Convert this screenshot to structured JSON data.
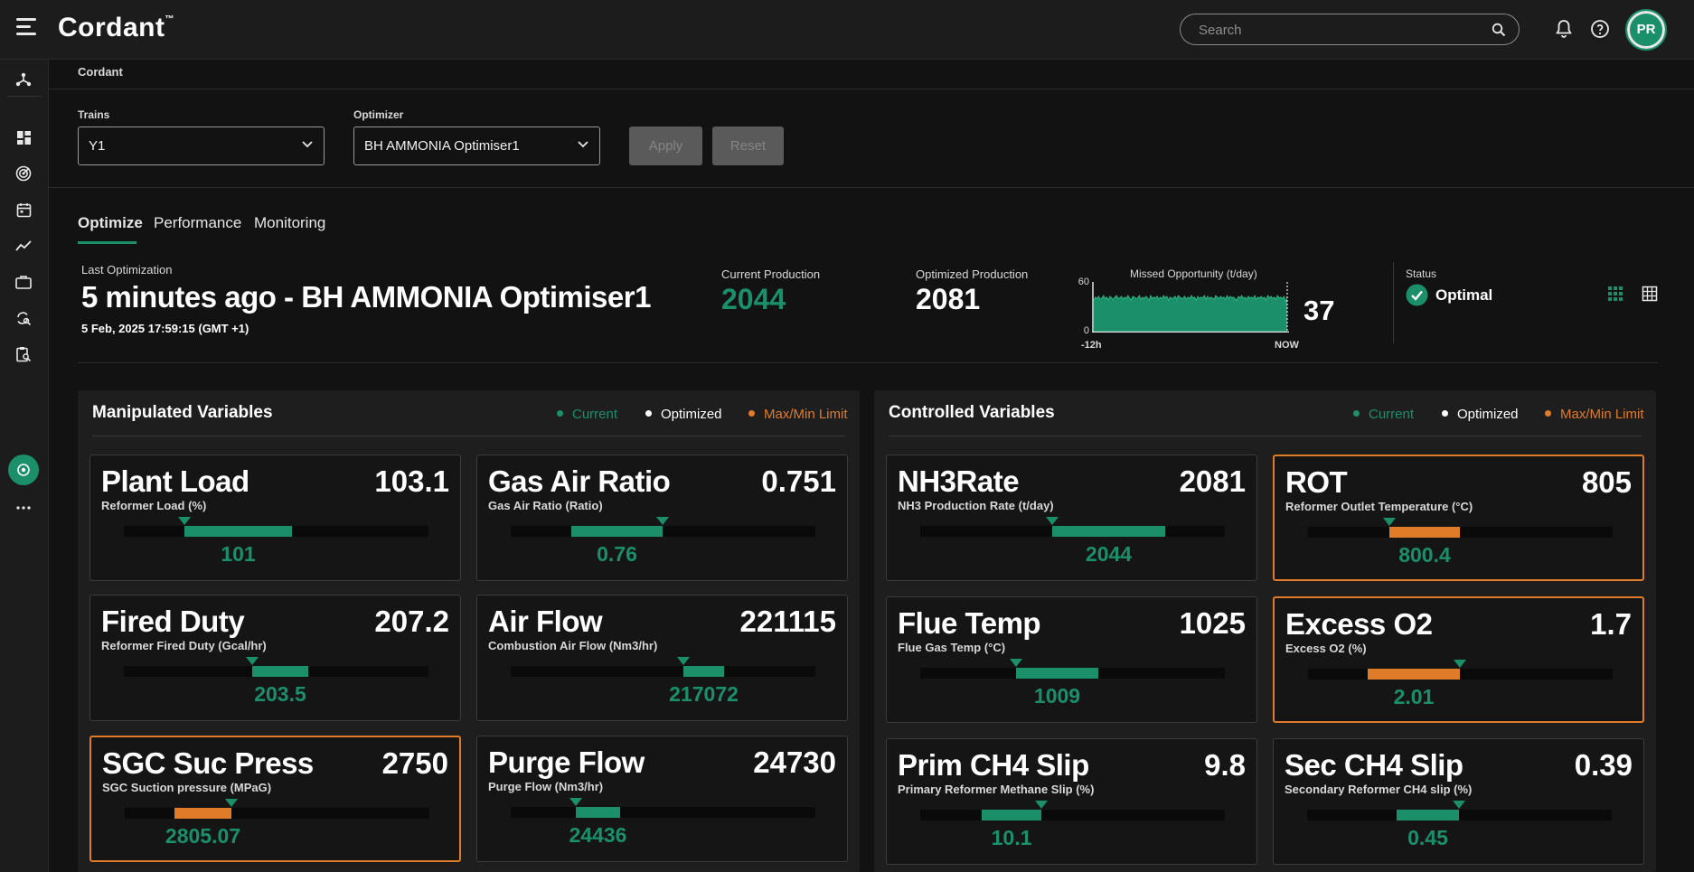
{
  "app": {
    "brand": "Cordant",
    "trademark": "™"
  },
  "search": {
    "placeholder": "Search"
  },
  "user": {
    "initials": "PR"
  },
  "breadcrumb": "Cordant",
  "filters": {
    "trains_label": "Trains",
    "trains_value": "Y1",
    "optimizer_label": "Optimizer",
    "optimizer_value": "BH AMMONIA Optimiser1",
    "apply_label": "Apply",
    "reset_label": "Reset"
  },
  "tabs": [
    {
      "label": "Optimize",
      "active": true
    },
    {
      "label": "Performance",
      "active": false
    },
    {
      "label": "Monitoring",
      "active": false
    }
  ],
  "summary": {
    "last_opt_label": "Last Optimization",
    "last_opt_title": "5 minutes ago - BH AMMONIA Optimiser1",
    "last_opt_date": "5 Feb, 2025 17:59:15 (GMT +1)",
    "current_label": "Current Production",
    "current_value": "2044",
    "optimized_label": "Optimized Production",
    "optimized_value": "2081",
    "missed_label": "Missed Opportunity (t/day)",
    "missed_value": "37",
    "spark_ymax": "60",
    "spark_ymin": "0",
    "spark_xstart": "-12h",
    "spark_xend": "NOW",
    "status_label": "Status",
    "status_value": "Optimal"
  },
  "chart_data": {
    "type": "area",
    "title": "Missed Opportunity (t/day)",
    "x_range": [
      "-12h",
      "NOW"
    ],
    "ylim": [
      0,
      60
    ],
    "values": [
      40,
      44,
      42,
      45,
      41,
      43,
      46,
      42,
      44,
      40,
      45,
      43,
      41,
      44,
      46,
      42,
      43,
      45,
      41,
      44,
      42,
      46,
      43,
      40,
      45,
      44,
      42,
      43,
      46,
      41,
      44,
      42,
      45,
      43,
      40,
      46,
      42,
      44,
      43,
      45,
      41,
      44,
      42,
      46,
      43,
      45,
      40,
      44,
      42,
      43,
      45,
      41,
      46,
      44,
      42,
      43,
      45,
      41,
      44,
      42,
      46,
      43,
      44,
      40,
      45,
      42,
      44,
      43,
      46,
      41,
      45,
      42,
      44,
      43,
      41,
      46,
      44,
      42,
      45,
      43,
      44,
      41,
      46,
      42,
      45,
      43,
      44,
      42,
      40,
      45,
      43,
      46,
      42,
      44,
      41,
      45,
      43,
      44,
      42,
      46,
      41,
      44,
      43,
      45,
      42,
      44,
      40,
      46,
      43,
      45,
      42,
      44,
      41,
      46,
      43,
      44,
      42,
      45,
      38,
      45
    ]
  },
  "legend": {
    "current": "Current",
    "optimized": "Optimized",
    "limit": "Max/Min Limit"
  },
  "colors": {
    "current": "#1b8f6a",
    "optimized": "#ffffff",
    "limit": "#e07b2a"
  },
  "manipulated": {
    "title": "Manipulated Variables",
    "cards": [
      {
        "name": "Plant Load",
        "sub": "Reformer Load (%)",
        "optimized": "103.1",
        "current": "101",
        "limit": false
      },
      {
        "name": "Gas Air Ratio",
        "sub": "Gas Air Ratio (Ratio)",
        "optimized": "0.751",
        "current": "0.76",
        "limit": false
      },
      {
        "name": "Fired Duty",
        "sub": "Reformer Fired Duty (Gcal/hr)",
        "optimized": "207.2",
        "current": "203.5",
        "limit": false
      },
      {
        "name": "Air Flow",
        "sub": "Combustion Air Flow (Nm3/hr)",
        "optimized": "221115",
        "current": "217072",
        "limit": false
      },
      {
        "name": "SGC Suc Press",
        "sub": "SGC Suction pressure (MPaG)",
        "optimized": "2750",
        "current": "2805.07",
        "limit": true
      },
      {
        "name": "Purge Flow",
        "sub": "Purge Flow (Nm3/hr)",
        "optimized": "24730",
        "current": "24436",
        "limit": false
      }
    ]
  },
  "controlled": {
    "title": "Controlled Variables",
    "cards": [
      {
        "name": "NH3Rate",
        "sub": "NH3 Production Rate (t/day)",
        "optimized": "2081",
        "current": "2044",
        "limit": false
      },
      {
        "name": "ROT",
        "sub": "Reformer Outlet Temperature (°C)",
        "optimized": "805",
        "current": "800.4",
        "limit": true
      },
      {
        "name": "Flue Temp",
        "sub": "Flue Gas Temp (°C)",
        "optimized": "1025",
        "current": "1009",
        "limit": false
      },
      {
        "name": "Excess O2",
        "sub": "Excess O2 (%)",
        "optimized": "1.7",
        "current": "2.01",
        "limit": true
      },
      {
        "name": "Prim CH4 Slip",
        "sub": "Primary Reformer Methane Slip (%)",
        "optimized": "9.8",
        "current": "10.1",
        "limit": false
      },
      {
        "name": "Sec CH4 Slip",
        "sub": "Secondary Reformer CH4 slip (%)",
        "optimized": "0.39",
        "current": "0.45",
        "limit": false
      }
    ]
  }
}
